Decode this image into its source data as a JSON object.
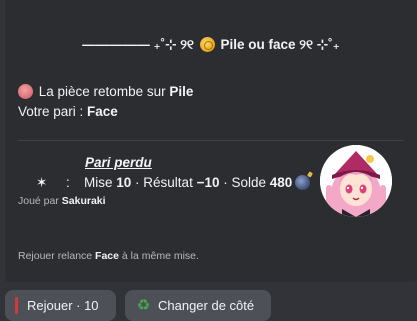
{
  "embed": {
    "title_prefix": "————— ₊˚⊹ ୨୧ ",
    "title_text": "Pile ou face",
    "title_suffix": " ୨୧ ⊹˚₊",
    "result_prefix": "La pièce retombe sur ",
    "result_value": "Pile",
    "bet_prefix": "Votre pari : ",
    "bet_value": "Face",
    "lost_title": "Pari perdu",
    "stats_star": "✶",
    "stats_colon": ":",
    "stake_label": "Mise ",
    "stake_value": "10",
    "result_label": " · Résultat ",
    "result_amount": "−10",
    "balance_label": " · Solde ",
    "balance_value": "480",
    "played_by_prefix": "Joué par ",
    "played_by_user": "Sakuraki",
    "footer_prefix": "Rejouer relance ",
    "footer_bold": "Face",
    "footer_suffix": " à la même mise."
  },
  "buttons": {
    "replay_label": "Rejouer · 10",
    "change_side_label": "Changer de côté"
  },
  "icons": {
    "coin": "coin-icon",
    "result_circle": "pink-circle-icon",
    "bomb": "bomb-icon",
    "stick": "red-stick-icon",
    "recycle": "recycle-icon"
  },
  "colors": {
    "background": "#313338",
    "embed": "#2b2d31",
    "button": "#4e5058",
    "text": "#f2f3f5",
    "muted": "#b5bac1"
  }
}
